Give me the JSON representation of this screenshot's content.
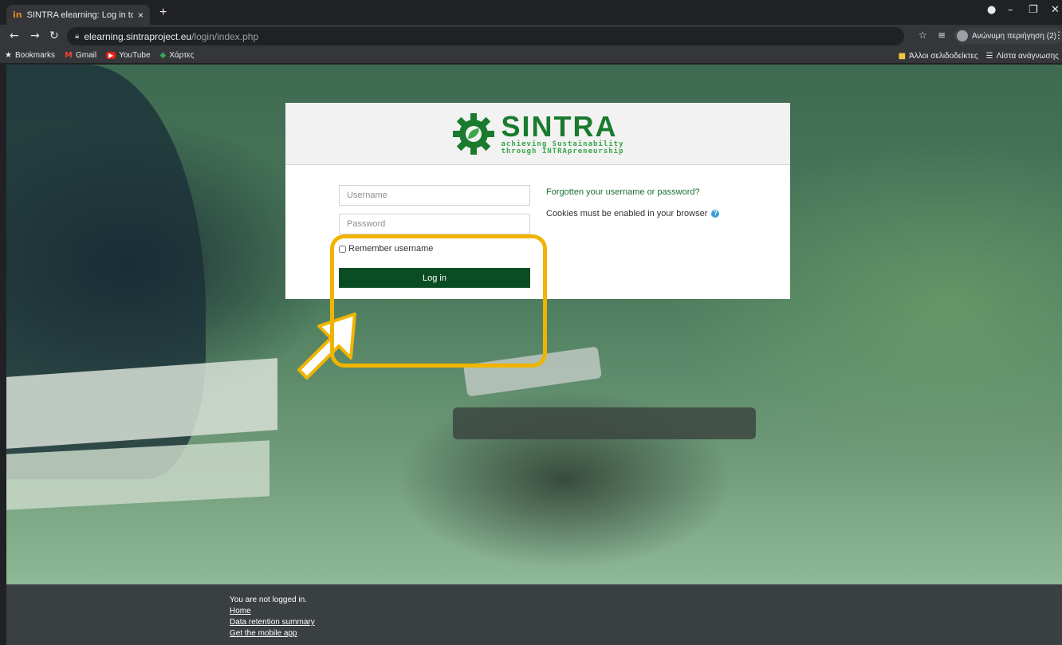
{
  "browser": {
    "tab_title": "SINTRA elearning: Log in to the ‹",
    "tab_favicon": "in",
    "tab_close": "×",
    "new_tab": "+",
    "url_host": "elearning.sintraproject.eu",
    "url_path": "/login/index.php",
    "profile_label": "Ανώνυμη περιήγηση (2)",
    "bookmarks": [
      {
        "label": "Bookmarks",
        "icon": "star-icon"
      },
      {
        "label": "Gmail",
        "icon": "gmail-icon"
      },
      {
        "label": "YouTube",
        "icon": "youtube-icon"
      },
      {
        "label": "Χάρτες",
        "icon": "maps-icon"
      }
    ],
    "other_bookmarks": "Άλλοι σελιδοδείκτες",
    "reading_list": "Λίστα ανάγνωσης"
  },
  "logo": {
    "title": "SINTRA",
    "tagline_1": "achieving Sustainability",
    "tagline_2": "through INTRApreneurship",
    "color": "#1a7a2e"
  },
  "login": {
    "username_placeholder": "Username",
    "password_placeholder": "Password",
    "remember_label": "Remember username",
    "login_button": "Log in",
    "forgot_link": "Forgotten your username or password?",
    "cookies_text": "Cookies must be enabled in your browser",
    "button_color": "#0a4d23",
    "highlight_color": "#f0b400"
  },
  "footer": {
    "status": "You are not logged in.",
    "links": [
      "Home",
      "Data retention summary",
      "Get the mobile app"
    ]
  }
}
